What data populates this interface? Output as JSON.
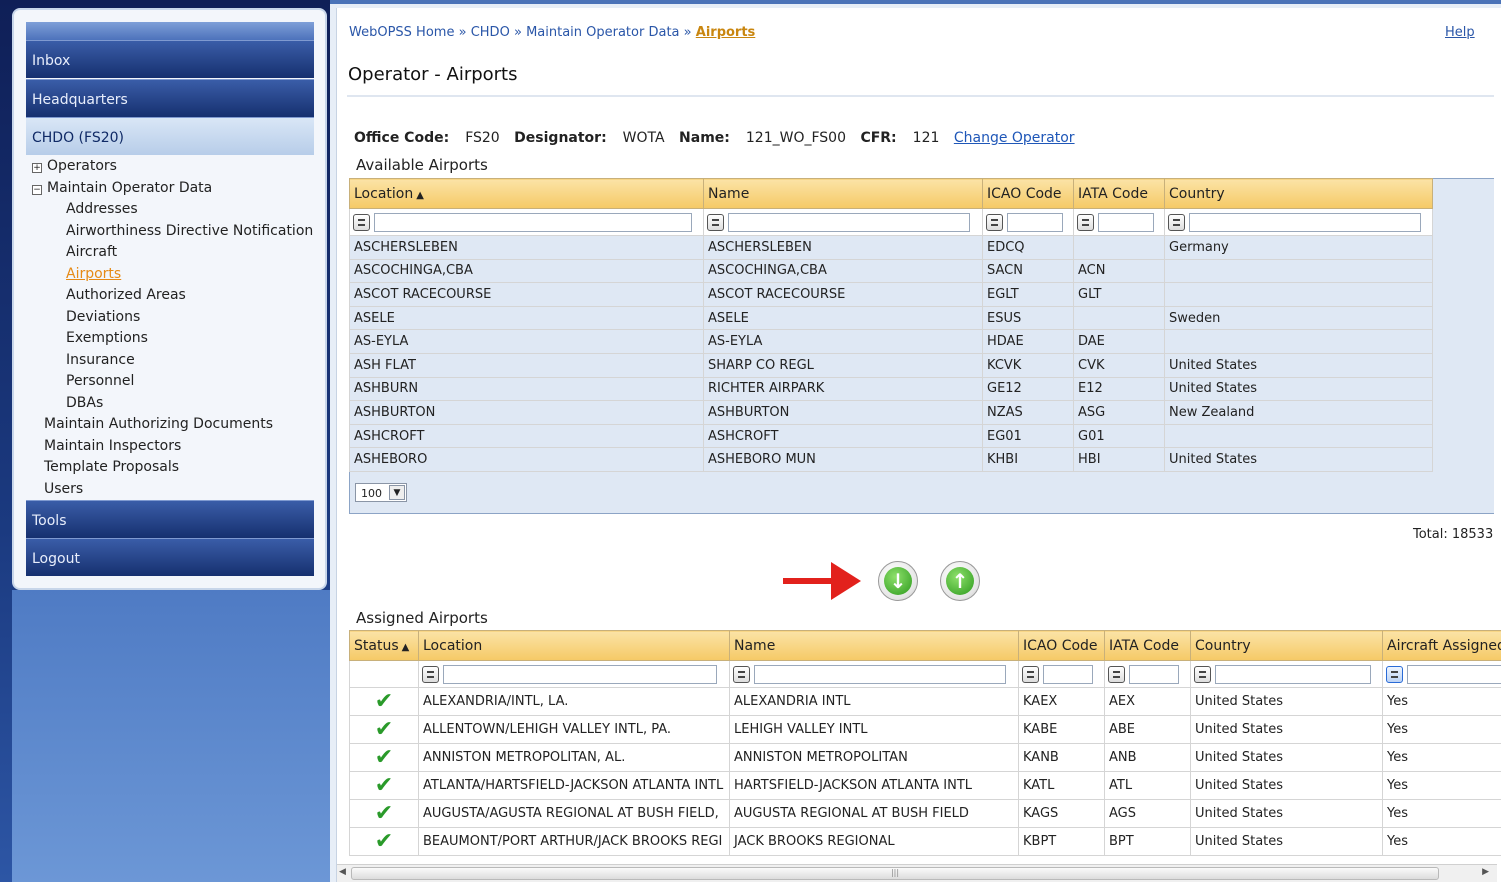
{
  "nav": {
    "inbox": "Inbox",
    "headquarters": "Headquarters",
    "office": "CHDO (FS20)",
    "tools": "Tools",
    "logout": "Logout",
    "tree": {
      "operators": "Operators",
      "maintain_operator_data": "Maintain Operator Data",
      "children": [
        "Addresses",
        "Airworthiness Directive Notification",
        "Aircraft",
        "Airports",
        "Authorized Areas",
        "Deviations",
        "Exemptions",
        "Insurance",
        "Personnel",
        "DBAs"
      ],
      "maintain_authorizing_documents": "Maintain Authorizing Documents",
      "maintain_inspectors": "Maintain Inspectors",
      "template_proposals": "Template Proposals",
      "users": "Users"
    }
  },
  "breadcrumb": {
    "home": "WebOPSS Home",
    "sep": "»",
    "chdo": "CHDO",
    "maintain": "Maintain Operator Data",
    "current": "Airports"
  },
  "help": "Help",
  "page_title": "Operator - Airports",
  "operator": {
    "office_code_label": "Office Code:",
    "office_code": "FS20",
    "designator_label": "Designator:",
    "designator": "WOTA",
    "name_label": "Name:",
    "name": "121_WO_FS00",
    "cfr_label": "CFR:",
    "cfr": "121",
    "change_link": "Change Operator"
  },
  "available": {
    "label": "Available Airports",
    "columns": [
      "Location",
      "Name",
      "ICAO Code",
      "IATA Code",
      "Country"
    ],
    "rows": [
      [
        "ASCHERSLEBEN",
        "ASCHERSLEBEN",
        "EDCQ",
        "",
        "Germany"
      ],
      [
        "ASCOCHINGA,CBA",
        "ASCOCHINGA,CBA",
        "SACN",
        "ACN",
        ""
      ],
      [
        "ASCOT RACECOURSE",
        "ASCOT RACECOURSE",
        "EGLT",
        "GLT",
        ""
      ],
      [
        "ASELE",
        "ASELE",
        "ESUS",
        "",
        "Sweden"
      ],
      [
        "AS-EYLA",
        "AS-EYLA",
        "HDAE",
        "DAE",
        ""
      ],
      [
        "ASH FLAT",
        "SHARP CO REGL",
        "KCVK",
        "CVK",
        "United States"
      ],
      [
        "ASHBURN",
        "RICHTER AIRPARK",
        "GE12",
        "E12",
        "United States"
      ],
      [
        "ASHBURTON",
        "ASHBURTON",
        "NZAS",
        "ASG",
        "New Zealand"
      ],
      [
        "ASHCROFT",
        "ASHCROFT",
        "EG01",
        "G01",
        ""
      ],
      [
        "ASHEBORO",
        "ASHEBORO MUN",
        "KHBI",
        "HBI",
        "United States"
      ]
    ],
    "page_size": "100",
    "total": "Total: 18533"
  },
  "assigned": {
    "label": "Assigned Airports",
    "columns": [
      "Status",
      "Location",
      "Name",
      "ICAO Code",
      "IATA Code",
      "Country",
      "Aircraft Assigned"
    ],
    "rows": [
      [
        "ALEXANDRIA/INTL, LA.",
        "ALEXANDRIA INTL",
        "KAEX",
        "AEX",
        "United States",
        "Yes"
      ],
      [
        "ALLENTOWN/LEHIGH VALLEY INTL, PA.",
        "LEHIGH VALLEY INTL",
        "KABE",
        "ABE",
        "United States",
        "Yes"
      ],
      [
        "ANNISTON METROPOLITAN, AL.",
        "ANNISTON METROPOLITAN",
        "KANB",
        "ANB",
        "United States",
        "Yes"
      ],
      [
        "ATLANTA/HARTSFIELD-JACKSON ATLANTA INTL",
        "HARTSFIELD-JACKSON ATLANTA INTL",
        "KATL",
        "ATL",
        "United States",
        "Yes"
      ],
      [
        "AUGUSTA/AGUSTA REGIONAL AT BUSH FIELD,",
        "AUGUSTA REGIONAL AT BUSH FIELD",
        "KAGS",
        "AGS",
        "United States",
        "Yes"
      ],
      [
        "BEAUMONT/PORT ARTHUR/JACK BROOKS REGI",
        "JACK BROOKS REGIONAL",
        "KBPT",
        "BPT",
        "United States",
        "Yes"
      ]
    ]
  },
  "icons": {
    "assign": "arrow-down-icon",
    "unassign": "arrow-up-icon",
    "status": "checkmark-icon"
  }
}
